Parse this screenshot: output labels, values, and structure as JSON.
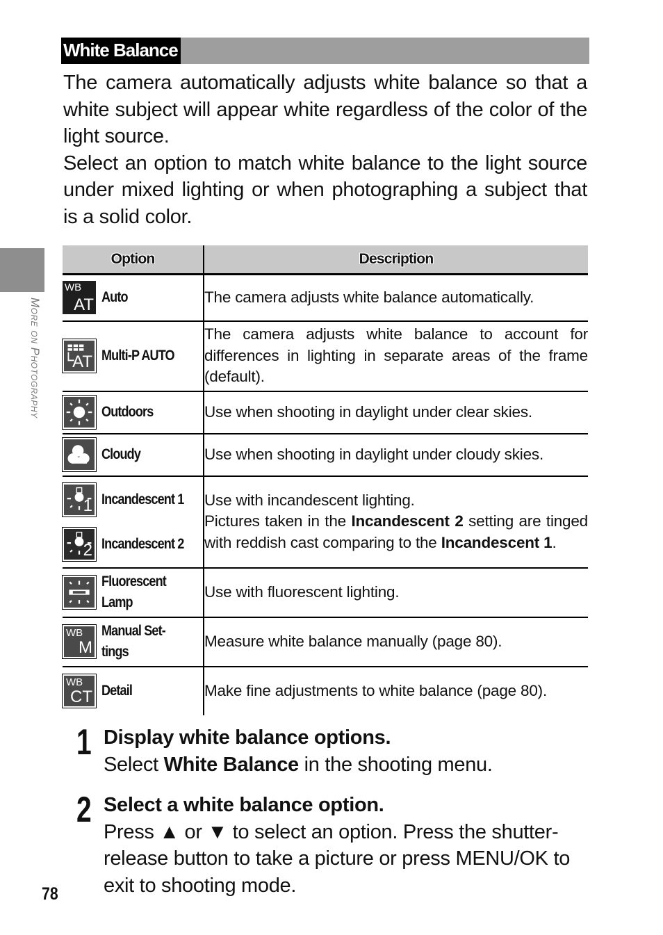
{
  "section": {
    "title": "White Balance"
  },
  "side_tab": {
    "label": "More on Photography"
  },
  "intro": {
    "paragraphs": [
      "The camera automatically adjusts white balance so that a white subject will appear white regardless of the color of the light source.",
      "Select an option to match white balance to the light source under mixed lighting or when photographing a subject that is a solid color."
    ]
  },
  "table": {
    "headers": {
      "option": "Option",
      "description": "Description"
    },
    "rows": [
      {
        "icon": "wb-auto-icon",
        "icon_text_small": "WB",
        "icon_text_big": "AT",
        "option": "Auto",
        "description": "The camera adjusts white balance automatically."
      },
      {
        "icon": "multi-p-auto-icon",
        "icon_text_big": "AT",
        "option": "Multi-P AUTO",
        "description": "The camera adjusts white balance to account for differences in lighting in separate areas of the frame (default)."
      },
      {
        "icon": "sun-icon",
        "option": "Outdoors",
        "description": "Use when shooting in daylight under clear skies."
      },
      {
        "icon": "cloud-icon",
        "option": "Cloudy",
        "description": "Use when shooting in daylight under cloudy skies."
      },
      {
        "icon": "incandescent-1-icon",
        "icon_text_big": "1",
        "option": "Incandescent 1"
      },
      {
        "icon": "incandescent-2-icon",
        "icon_text_big": "2",
        "option": "Incandescent 2"
      },
      {
        "icon": "fluorescent-icon",
        "option": "Fluorescent Lamp",
        "description": "Use with fluorescent lighting."
      },
      {
        "icon": "wb-manual-icon",
        "icon_text_small": "WB",
        "icon_text_big": "M",
        "option": "Manual Set- tings",
        "description": "Measure white balance manually (page 80)."
      },
      {
        "icon": "wb-detail-icon",
        "icon_text_small": "WB",
        "icon_text_big": "CT",
        "option": "Detail",
        "description": "Make fine adjustments to white balance (page 80)."
      }
    ],
    "incandescent_description": {
      "line1": "Use with incandescent lighting.",
      "part_a": "Pictures taken in the ",
      "bold_a": "Incandescent 2",
      "part_b": " setting are tinged with reddish cast comparing to the ",
      "bold_b": "Incandescent 1",
      "part_c": "."
    }
  },
  "steps": [
    {
      "number": "1",
      "heading": "Display white balance options.",
      "text_a": "Select ",
      "bold": "White Balance",
      "text_b": " in the shooting menu."
    },
    {
      "number": "2",
      "heading": "Select a white balance option.",
      "text_a": "Press ",
      "up_glyph": "▲",
      "text_mid": " or ",
      "down_glyph": "▼",
      "text_b": " to select an option. Press the shutter-release button to take a picture or press ",
      "button_label": "MENU/OK",
      "text_c": " to exit to shooting mode."
    }
  ],
  "page_number": "78"
}
